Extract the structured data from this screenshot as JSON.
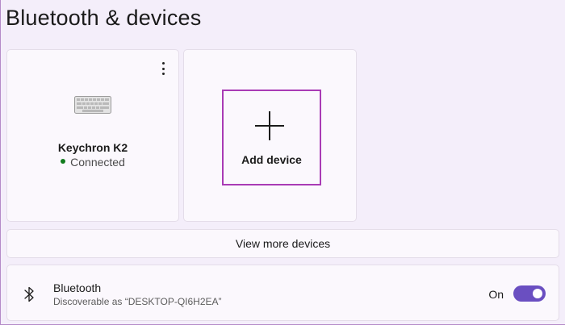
{
  "page": {
    "title": "Bluetooth & devices"
  },
  "device": {
    "name": "Keychron K2",
    "status": "Connected",
    "icon": "keyboard-icon",
    "status_color": "#117c1d"
  },
  "add_device": {
    "label": "Add device",
    "icon": "plus-icon",
    "highlight_color": "#a93bb5"
  },
  "view_more": {
    "label": "View more devices"
  },
  "bluetooth": {
    "title": "Bluetooth",
    "subtitle": "Discoverable as “DESKTOP-QI6H2EA”",
    "state_label": "On",
    "enabled": true,
    "icon": "bluetooth-icon",
    "accent": "#6a4fc1"
  }
}
